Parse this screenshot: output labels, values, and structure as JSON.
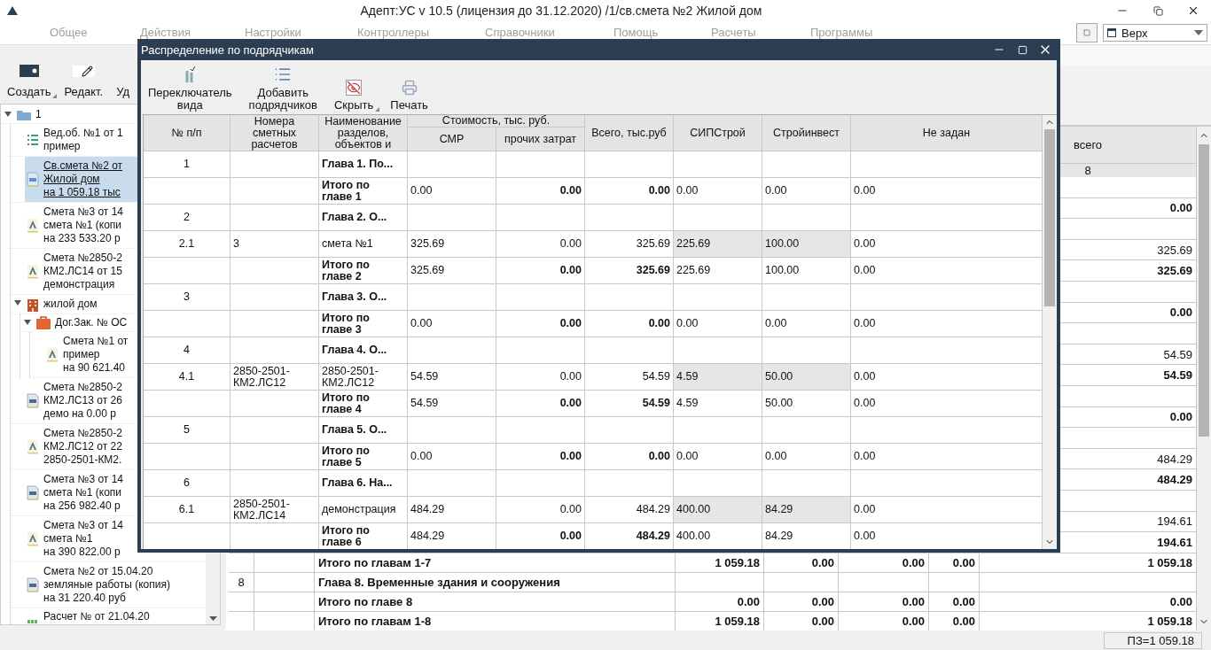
{
  "window": {
    "title": "Адепт:УС v 10.5 (лицензия до 31.12.2020) /1/св.смета №2 Жилой дом"
  },
  "menu": [
    {
      "label": "Общее",
      "disabled": true
    },
    {
      "label": "Действия",
      "disabled": true
    },
    {
      "label": "Настройки",
      "disabled": true
    },
    {
      "label": "Контроллеры",
      "disabled": true
    },
    {
      "label": "Справочники",
      "disabled": true
    },
    {
      "label": "Помощь",
      "disabled": true
    },
    {
      "label": "Расчеты",
      "disabled": true
    },
    {
      "label": "Программы",
      "disabled": true
    }
  ],
  "view_selector": {
    "value": "Верх"
  },
  "left_panel": {
    "toolbar": [
      {
        "label": "Создать",
        "kind": "create",
        "has_menu": true
      },
      {
        "label": "Редакт.",
        "kind": "edit",
        "has_menu": false
      },
      {
        "label": "Уд",
        "kind": "delete",
        "has_menu": false
      }
    ],
    "tree": [
      {
        "lines": [
          "1"
        ],
        "kind": "folder",
        "selected": false,
        "expanded": true,
        "children": [
          {
            "lines": [
              "Вед.об. №1 от 1",
              "пример"
            ],
            "kind": "sheet",
            "selected": false
          },
          {
            "lines": [
              "Св.смета №2 от",
              "Жилой дом",
              "на 1 059.18 тыс"
            ],
            "kind": "summary",
            "selected": true
          },
          {
            "lines": [
              "Смета №3 от 14",
              "смета №1 (копи",
              "на 233 533.20 р"
            ],
            "kind": "estimate_a",
            "selected": false
          },
          {
            "lines": [
              "Смета №2850-2",
              "КМ2.ЛС14 от 15",
              "демонстрация"
            ],
            "kind": "estimate_a",
            "selected": false
          },
          {
            "lines": [
              "жилой дом"
            ],
            "kind": "building",
            "selected": false,
            "expanded": true,
            "children": [
              {
                "lines": [
                  "Дог.Зак. № ОС"
                ],
                "kind": "contract",
                "selected": false,
                "expanded": true,
                "children": [
                  {
                    "lines": [
                      "Смета №1 от",
                      "пример",
                      "на 90 621.40"
                    ],
                    "kind": "estimate_a",
                    "selected": false
                  }
                ]
              }
            ]
          },
          {
            "lines": [
              "Смета №2850-2",
              "КМ2.ЛС13 от 26",
              "демо   на 0.00 р"
            ],
            "kind": "estimate_c",
            "selected": false
          },
          {
            "lines": [
              "Смета №2850-2",
              "КМ2.ЛС12 от 22",
              "2850-2501-КМ2."
            ],
            "kind": "estimate_a",
            "selected": false
          },
          {
            "lines": [
              "Смета №3 от 14",
              "смета №1 (копи",
              "на 256 982.40 р"
            ],
            "kind": "estimate_c",
            "selected": false
          },
          {
            "lines": [
              "Смета №3 от 14",
              "смета №1",
              "на 390 822.00 р"
            ],
            "kind": "estimate_a",
            "selected": false
          },
          {
            "lines": [
              "Смета №2 от 15.04.20",
              "земляные работы (копия)",
              "на 31 220.40 руб"
            ],
            "kind": "estimate_c",
            "selected": false
          },
          {
            "lines": [
              "Расчет № от 21.04.20"
            ],
            "kind": "calc",
            "selected": false
          }
        ]
      }
    ]
  },
  "main_table": {
    "total_column": "всего",
    "total_index": "8",
    "rows": [
      {
        "kind": "blank"
      },
      {
        "kind": "subtotal",
        "total": "0.00"
      },
      {
        "kind": "blank"
      },
      {
        "kind": "item",
        "total": "325.69"
      },
      {
        "kind": "subtotal",
        "total": "325.69"
      },
      {
        "kind": "blank"
      },
      {
        "kind": "subtotal",
        "total": "0.00"
      },
      {
        "kind": "blank"
      },
      {
        "kind": "item",
        "total": "54.59"
      },
      {
        "kind": "subtotal",
        "total": "54.59"
      },
      {
        "kind": "blank"
      },
      {
        "kind": "subtotal",
        "total": "0.00"
      },
      {
        "kind": "blank"
      },
      {
        "kind": "item",
        "total": "484.29"
      },
      {
        "kind": "subtotal",
        "total": "484.29"
      },
      {
        "kind": "blank"
      },
      {
        "kind": "item",
        "total": "194.61"
      },
      {
        "kind": "subtotal",
        "total": "194.61"
      },
      {
        "kind": "subtotal",
        "name": "Итого по главам 1-7",
        "column_4": "1 059.18",
        "column_5": "0.00",
        "column_6": "0.00",
        "column_7": "0.00",
        "total": "1 059.18"
      },
      {
        "kind": "chapter",
        "number": "8",
        "name": "Глава 8. Временные здания и сооружения"
      },
      {
        "kind": "subtotal",
        "name": "Итого по главе 8",
        "column_4": "0.00",
        "column_5": "0.00",
        "column_6": "0.00",
        "column_7": "0.00",
        "total": "0.00"
      },
      {
        "kind": "subtotal",
        "name": "Итого по главам 1-8",
        "column_4": "1 059.18",
        "column_5": "0.00",
        "column_6": "0.00",
        "column_7": "0.00",
        "total": "1 059.18"
      }
    ]
  },
  "status_bar": {
    "text": "ПЗ=1 059.18"
  },
  "dialog": {
    "title": "Распределение по подрядчикам",
    "toolbar": [
      {
        "label": "Переключатель\nвида",
        "kind": "switch",
        "has_menu": false
      },
      {
        "label": "Добавить\nподрядчиков",
        "kind": "list",
        "has_menu": false
      },
      {
        "label": "Скрыть",
        "kind": "hide",
        "has_menu": true
      },
      {
        "label": "Печать",
        "kind": "print",
        "has_menu": false
      }
    ],
    "table": {
      "column_group": "Стоимость, тыс. руб.",
      "columns": [
        "№ п/п",
        "Номера\nсметных\nрасчетов",
        "Наименование\nразделов,\nобъектов и",
        "СМР",
        "прочих затрат",
        "Всего, тыс.руб",
        "СИПСтрой",
        "Стройинвест",
        "Не задан"
      ],
      "rows": [
        {
          "kind": "chapter",
          "number": "1",
          "name": "Глава 1. По..."
        },
        {
          "kind": "total",
          "name": "Итого по\nглаве 1",
          "smr": "0.00",
          "other": "0.00",
          "sum": "0.00",
          "sip": "0.00",
          "stroy": "0.00",
          "unset": "0.00"
        },
        {
          "kind": "chapter",
          "number": "2",
          "name": "Глава 2. О..."
        },
        {
          "kind": "item",
          "number": "2.1",
          "estimate": "3",
          "name": "смета №1",
          "smr": "325.69",
          "other": "0.00",
          "sum": "325.69",
          "sip": "225.69",
          "stroy": "100.00",
          "unset": "0.00"
        },
        {
          "kind": "total",
          "name": "Итого по\nглаве 2",
          "smr": "325.69",
          "other": "0.00",
          "sum": "325.69",
          "sip": "225.69",
          "stroy": "100.00",
          "unset": "0.00"
        },
        {
          "kind": "chapter",
          "number": "3",
          "name": "Глава 3. О..."
        },
        {
          "kind": "total",
          "name": "Итого по\nглаве 3",
          "smr": "0.00",
          "other": "0.00",
          "sum": "0.00",
          "sip": "0.00",
          "stroy": "0.00",
          "unset": "0.00"
        },
        {
          "kind": "chapter",
          "number": "4",
          "name": "Глава 4. О..."
        },
        {
          "kind": "item",
          "number": "4.1",
          "estimate": "2850-2501-\nКМ2.ЛС12",
          "name": "2850-2501-\nКМ2.ЛС12",
          "smr": "54.59",
          "other": "0.00",
          "sum": "54.59",
          "sip": "4.59",
          "stroy": "50.00",
          "unset": "0.00"
        },
        {
          "kind": "total",
          "name": "Итого по\nглаве 4",
          "smr": "54.59",
          "other": "0.00",
          "sum": "54.59",
          "sip": "4.59",
          "stroy": "50.00",
          "unset": "0.00"
        },
        {
          "kind": "chapter",
          "number": "5",
          "name": "Глава 5. О..."
        },
        {
          "kind": "total",
          "name": "Итого по\nглаве 5",
          "smr": "0.00",
          "other": "0.00",
          "sum": "0.00",
          "sip": "0.00",
          "stroy": "0.00",
          "unset": "0.00"
        },
        {
          "kind": "chapter",
          "number": "6",
          "name": "Глава 6. На..."
        },
        {
          "kind": "item",
          "number": "6.1",
          "estimate": "2850-2501-\nКМ2.ЛС14",
          "name": "демонстрация",
          "smr": "484.29",
          "other": "0.00",
          "sum": "484.29",
          "sip": "400.00",
          "stroy": "84.29",
          "unset": "0.00"
        },
        {
          "kind": "total",
          "name": "Итого по\nглаве 6",
          "smr": "484.29",
          "other": "0.00",
          "sum": "484.29",
          "sip": "400.00",
          "stroy": "84.29",
          "unset": "0.00"
        }
      ]
    }
  }
}
